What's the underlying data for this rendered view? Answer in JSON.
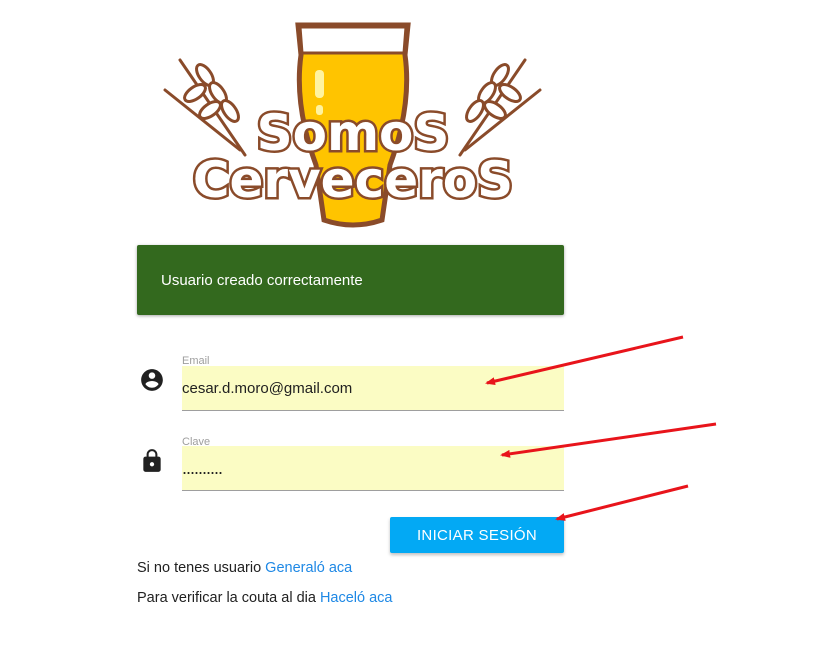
{
  "logo": {
    "line1": "SomoS",
    "line2": "CervecerоS",
    "alt": "Somos Cerveceros logo"
  },
  "alert": {
    "message": "Usuario creado correctamente",
    "color": "#33691e"
  },
  "form": {
    "email": {
      "label": "Email",
      "value": "cesar.d.moro@gmail.com",
      "icon": "account-circle-icon"
    },
    "password": {
      "label": "Clave",
      "value": "..........",
      "icon": "lock-icon"
    },
    "submit_label": "INICIAR SESIÓN",
    "autofill_color": "#fbfcc4",
    "button_color": "#03a9f4"
  },
  "register": {
    "text": "Si no tenes usuario",
    "link": "Generaló aca"
  },
  "verify": {
    "text": "Para verificar la couta al dia",
    "link": "Haceló aca"
  },
  "annotations": {
    "arrow_color": "#e8141b"
  }
}
